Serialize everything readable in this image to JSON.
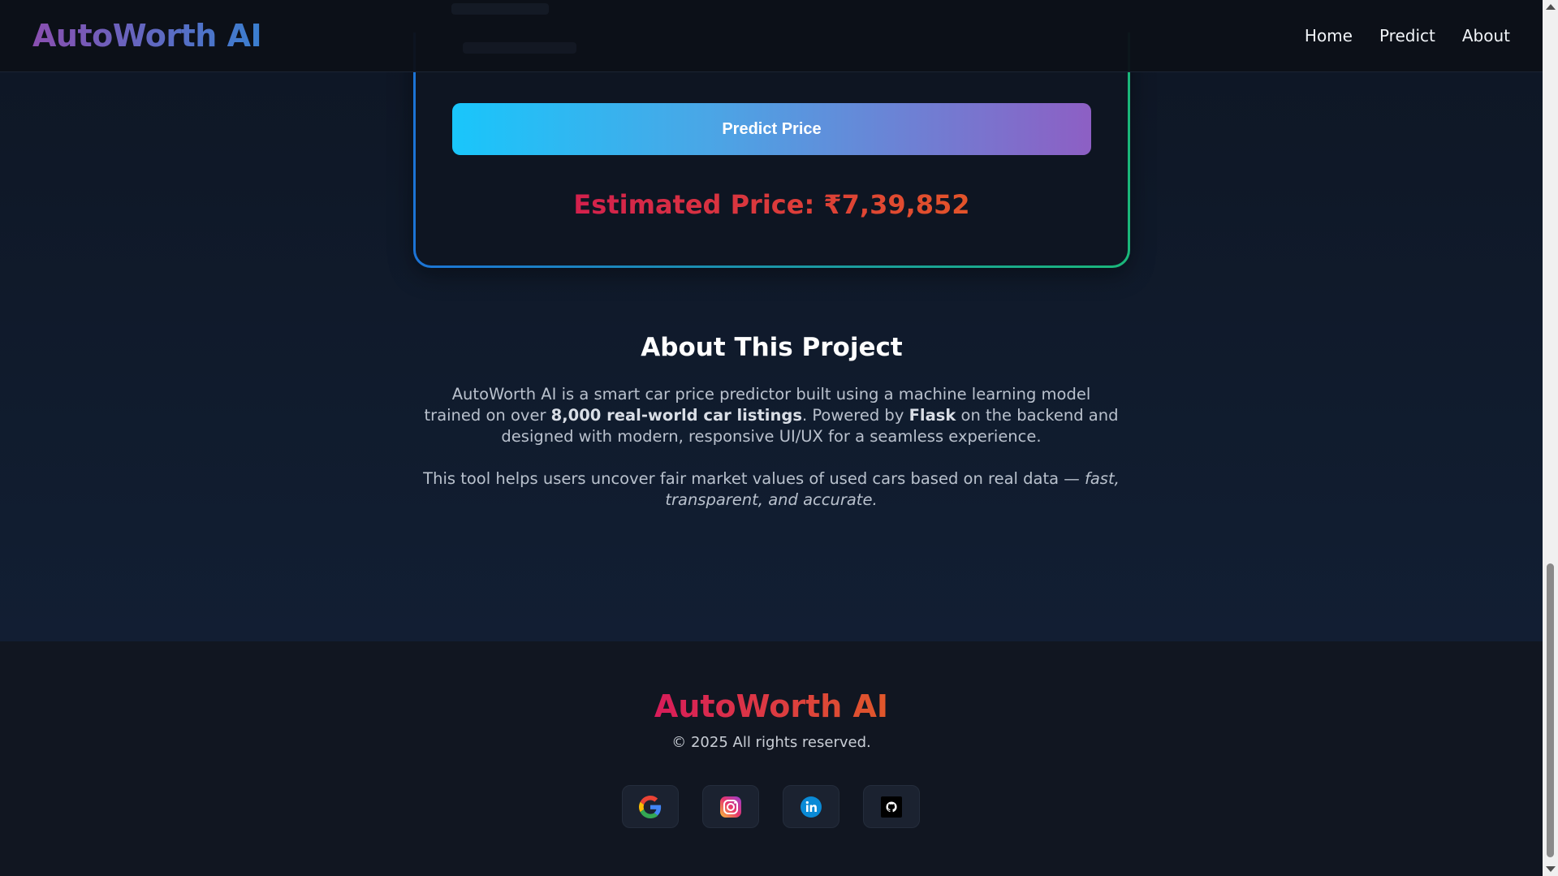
{
  "header": {
    "logo": "AutoWorth AI",
    "nav": [
      "Home",
      "Predict",
      "About"
    ]
  },
  "predict": {
    "button_label": "Predict Price",
    "estimate_text": "Estimated Price: ₹7,39,852"
  },
  "about": {
    "title": "About This Project",
    "p1_a": "AutoWorth AI is a smart car price predictor built using a machine learning model trained on over ",
    "p1_b": "8,000 real-world car listings",
    "p1_c": ". Powered by ",
    "p1_d": "Flask",
    "p1_e": " on the backend and designed with modern, responsive UI/UX for a seamless experience.",
    "p2_a": "This tool helps users uncover fair market values of used cars based on real data — ",
    "p2_b": "fast, transparent, and accurate."
  },
  "footer": {
    "logo": "AutoWorth AI",
    "copyright": "© 2025 All rights reserved.",
    "socials": [
      "google-icon",
      "instagram-icon",
      "linkedin-icon",
      "github-icon"
    ]
  },
  "colors": {
    "accent_start": "#19c6fb",
    "accent_end": "#8d5fc4",
    "price": "#d3204d",
    "card_border_start": "#1c74d6",
    "card_border_end": "#1ab77a"
  }
}
